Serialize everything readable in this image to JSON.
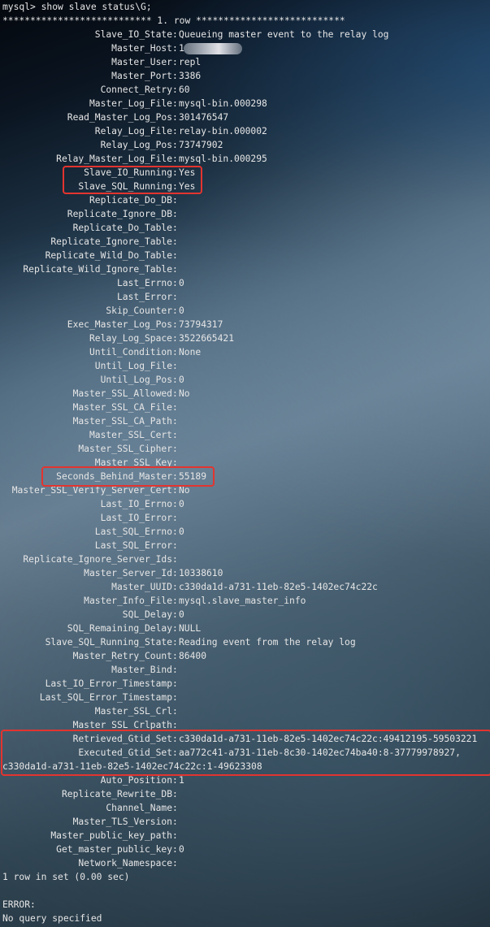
{
  "prompt_line": "mysql> show slave status\\G;",
  "row_header": "*************************** 1. row ***************************",
  "rows": [
    {
      "key": "Slave_IO_State",
      "value": "Queueing master event to the relay log"
    },
    {
      "key": "Master_Host",
      "value": "1"
    },
    {
      "key": "Master_User",
      "value": "repl"
    },
    {
      "key": "Master_Port",
      "value": "3386"
    },
    {
      "key": "Connect_Retry",
      "value": "60"
    },
    {
      "key": "Master_Log_File",
      "value": "mysql-bin.000298"
    },
    {
      "key": "Read_Master_Log_Pos",
      "value": "301476547"
    },
    {
      "key": "Relay_Log_File",
      "value": "relay-bin.000002"
    },
    {
      "key": "Relay_Log_Pos",
      "value": "73747902"
    },
    {
      "key": "Relay_Master_Log_File",
      "value": "mysql-bin.000295"
    },
    {
      "key": "Slave_IO_Running",
      "value": "Yes"
    },
    {
      "key": "Slave_SQL_Running",
      "value": "Yes"
    },
    {
      "key": "Replicate_Do_DB",
      "value": ""
    },
    {
      "key": "Replicate_Ignore_DB",
      "value": ""
    },
    {
      "key": "Replicate_Do_Table",
      "value": ""
    },
    {
      "key": "Replicate_Ignore_Table",
      "value": ""
    },
    {
      "key": "Replicate_Wild_Do_Table",
      "value": ""
    },
    {
      "key": "Replicate_Wild_Ignore_Table",
      "value": ""
    },
    {
      "key": "Last_Errno",
      "value": "0"
    },
    {
      "key": "Last_Error",
      "value": ""
    },
    {
      "key": "Skip_Counter",
      "value": "0"
    },
    {
      "key": "Exec_Master_Log_Pos",
      "value": "73794317"
    },
    {
      "key": "Relay_Log_Space",
      "value": "3522665421"
    },
    {
      "key": "Until_Condition",
      "value": "None"
    },
    {
      "key": "Until_Log_File",
      "value": ""
    },
    {
      "key": "Until_Log_Pos",
      "value": "0"
    },
    {
      "key": "Master_SSL_Allowed",
      "value": "No"
    },
    {
      "key": "Master_SSL_CA_File",
      "value": ""
    },
    {
      "key": "Master_SSL_CA_Path",
      "value": ""
    },
    {
      "key": "Master_SSL_Cert",
      "value": ""
    },
    {
      "key": "Master_SSL_Cipher",
      "value": ""
    },
    {
      "key": "Master_SSL_Key",
      "value": ""
    },
    {
      "key": "Seconds_Behind_Master",
      "value": "55189"
    },
    {
      "key": "Master_SSL_Verify_Server_Cert",
      "value": "No"
    },
    {
      "key": "Last_IO_Errno",
      "value": "0"
    },
    {
      "key": "Last_IO_Error",
      "value": ""
    },
    {
      "key": "Last_SQL_Errno",
      "value": "0"
    },
    {
      "key": "Last_SQL_Error",
      "value": ""
    },
    {
      "key": "Replicate_Ignore_Server_Ids",
      "value": ""
    },
    {
      "key": "Master_Server_Id",
      "value": "10338610"
    },
    {
      "key": "Master_UUID",
      "value": "c330da1d-a731-11eb-82e5-1402ec74c22c"
    },
    {
      "key": "Master_Info_File",
      "value": "mysql.slave_master_info"
    },
    {
      "key": "SQL_Delay",
      "value": "0"
    },
    {
      "key": "SQL_Remaining_Delay",
      "value": "NULL"
    },
    {
      "key": "Slave_SQL_Running_State",
      "value": "Reading event from the relay log"
    },
    {
      "key": "Master_Retry_Count",
      "value": "86400"
    },
    {
      "key": "Master_Bind",
      "value": ""
    },
    {
      "key": "Last_IO_Error_Timestamp",
      "value": ""
    },
    {
      "key": "Last_SQL_Error_Timestamp",
      "value": ""
    },
    {
      "key": "Master_SSL_Crl",
      "value": ""
    },
    {
      "key": "Master_SSL_Crlpath",
      "value": ""
    },
    {
      "key": "Retrieved_Gtid_Set",
      "value": "c330da1d-a731-11eb-82e5-1402ec74c22c:49412195-59503221"
    },
    {
      "key": "Executed_Gtid_Set",
      "value": "aa772c41-a731-11eb-8c30-1402ec74ba40:8-37779978927,"
    },
    {
      "key": "",
      "value": "c330da1d-a731-11eb-82e5-1402ec74c22c:1-49623308",
      "continuation": true
    },
    {
      "key": "Auto_Position",
      "value": "1"
    },
    {
      "key": "Replicate_Rewrite_DB",
      "value": ""
    },
    {
      "key": "Channel_Name",
      "value": ""
    },
    {
      "key": "Master_TLS_Version",
      "value": ""
    },
    {
      "key": "Master_public_key_path",
      "value": ""
    },
    {
      "key": "Get_master_public_key",
      "value": "0"
    },
    {
      "key": "Network_Namespace",
      "value": ""
    }
  ],
  "footer_lines": [
    "1 row in set (0.00 sec)",
    "",
    "ERROR:",
    "No query specified"
  ],
  "colors": {
    "highlight": "#e3342f",
    "text": "#e6e6e6"
  }
}
